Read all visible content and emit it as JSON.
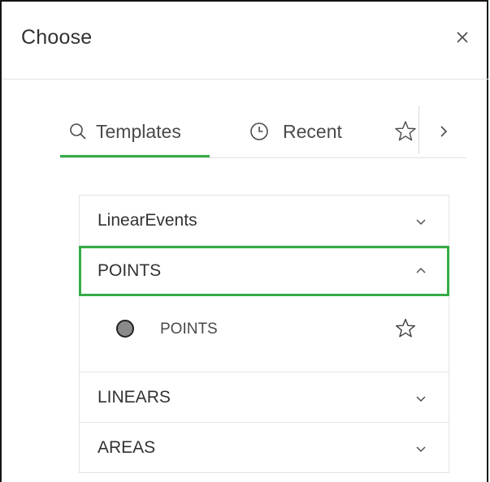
{
  "panel": {
    "title": "Choose",
    "close_icon": "close-icon"
  },
  "tabs": [
    {
      "label": "Templates",
      "icon": "search-icon",
      "selected": true
    },
    {
      "label": "Recent",
      "icon": "clock-icon",
      "selected": false
    },
    {
      "label": "",
      "icon": "star-icon",
      "selected": false
    }
  ],
  "tab_scroll_icon": "chevron-right-icon",
  "groups": [
    {
      "label": "LinearEvents",
      "expanded": false
    },
    {
      "label": "POINTS",
      "expanded": true,
      "items": [
        {
          "label": "POINTS",
          "symbol": "gray-circle",
          "favorite": false
        }
      ]
    },
    {
      "label": "LINEARS",
      "expanded": false
    },
    {
      "label": "AREAS",
      "expanded": false
    }
  ],
  "colors": {
    "accent": "#35ac46",
    "text": "#323232",
    "border": "#e4e4e4",
    "point_fill": "#8a8a8a"
  }
}
